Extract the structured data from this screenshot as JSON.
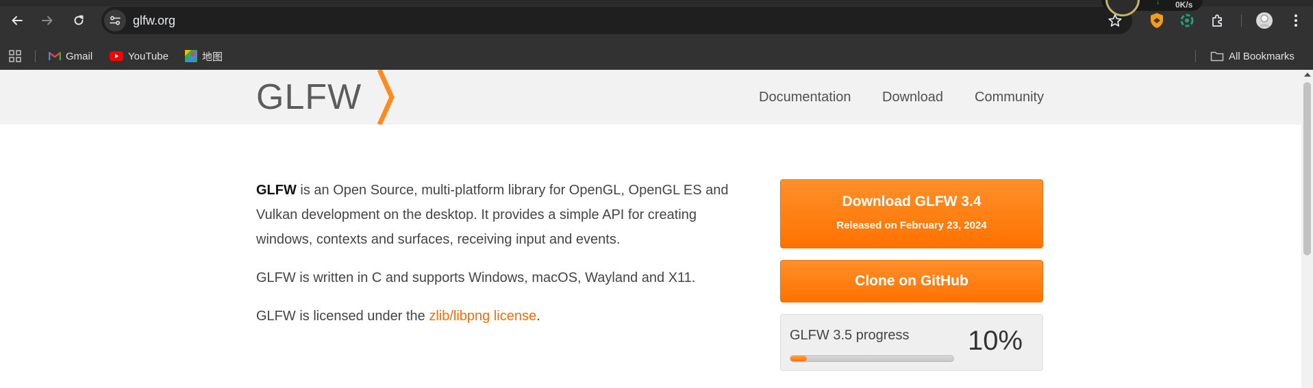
{
  "browser": {
    "url": "glfw.org",
    "net_speed": "0K/s",
    "icons": {
      "back": "arrow-left-icon",
      "forward": "arrow-right-icon",
      "reload": "reload-icon",
      "site_info": "tune-icon",
      "bookmark": "star-icon",
      "extensions": "puzzle-icon",
      "menu": "kebab-icon"
    },
    "bookmarks": [
      {
        "label": "Gmail",
        "icon": "gmail-icon"
      },
      {
        "label": "YouTube",
        "icon": "youtube-icon"
      },
      {
        "label": "地图",
        "icon": "maps-icon"
      }
    ],
    "all_bookmarks": "All Bookmarks"
  },
  "site": {
    "logo": "GLFW",
    "nav": [
      {
        "label": "Documentation"
      },
      {
        "label": "Download"
      },
      {
        "label": "Community"
      }
    ]
  },
  "intro": {
    "p1_bold": "GLFW",
    "p1_rest": " is an Open Source, multi-platform library for OpenGL, OpenGL ES and Vulkan development on the desktop. It provides a simple API for creating windows, contexts and surfaces, receiving input and events.",
    "p2": "GLFW is written in C and supports Windows, macOS, Wayland and X11.",
    "p3_before": "GLFW is licensed under the ",
    "p3_link": "zlib/libpng license",
    "p3_after": "."
  },
  "download": {
    "title": "Download GLFW 3.4",
    "subtitle": "Released on February 23, 2024"
  },
  "github": {
    "label": "Clone on GitHub"
  },
  "progress": {
    "label": "GLFW 3.5 progress",
    "percent_text": "10%",
    "value": 0.1
  },
  "colors": {
    "accent": "#ff7200",
    "link": "#ff6a00",
    "chrome_bg": "#323232"
  }
}
